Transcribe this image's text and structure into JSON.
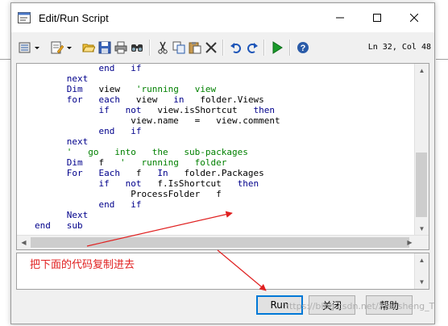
{
  "window": {
    "title": "Edit/Run Script"
  },
  "toolbar": {
    "cursor_position": "Ln 32, Col 48",
    "icons": [
      "code-menu-icon",
      "edit-menu-icon",
      "open-folder-icon",
      "save-icon",
      "print-icon",
      "find-icon",
      "cut-icon",
      "copy-icon",
      "paste-icon",
      "delete-icon",
      "undo-icon",
      "redo-icon",
      "run-icon",
      "help-icon"
    ]
  },
  "code_lines": [
    [
      {
        "t": "            end   if",
        "c": "kw"
      }
    ],
    [
      {
        "t": "      next",
        "c": "kw"
      }
    ],
    [
      {
        "t": "      Dim",
        "c": "kw"
      },
      {
        "t": "   view   ",
        "c": "id"
      },
      {
        "t": "'running   view",
        "c": "cm"
      }
    ],
    [
      {
        "t": "      for",
        "c": "kw"
      },
      {
        "t": "   ",
        "c": "id"
      },
      {
        "t": "each",
        "c": "kw"
      },
      {
        "t": "   view   ",
        "c": "id"
      },
      {
        "t": "in",
        "c": "kw"
      },
      {
        "t": "   folder.Views",
        "c": "id"
      }
    ],
    [
      {
        "t": "            if",
        "c": "kw"
      },
      {
        "t": "   ",
        "c": "id"
      },
      {
        "t": "not",
        "c": "kw"
      },
      {
        "t": "   view.isShortcut   ",
        "c": "id"
      },
      {
        "t": "then",
        "c": "kw"
      }
    ],
    [
      {
        "t": "                  view.name   =   view.comment",
        "c": "id"
      }
    ],
    [
      {
        "t": "            end   if",
        "c": "kw"
      }
    ],
    [
      {
        "t": "      next",
        "c": "kw"
      }
    ],
    [
      {
        "t": "      '   go   into   the   sub-packages",
        "c": "cm"
      }
    ],
    [
      {
        "t": "      Dim",
        "c": "kw"
      },
      {
        "t": "   f   ",
        "c": "id"
      },
      {
        "t": "'   running   folder",
        "c": "cm"
      }
    ],
    [
      {
        "t": "      For",
        "c": "kw"
      },
      {
        "t": "   ",
        "c": "id"
      },
      {
        "t": "Each",
        "c": "kw"
      },
      {
        "t": "   f   ",
        "c": "id"
      },
      {
        "t": "In",
        "c": "kw"
      },
      {
        "t": "   folder.Packages",
        "c": "id"
      }
    ],
    [
      {
        "t": "            if",
        "c": "kw"
      },
      {
        "t": "   ",
        "c": "id"
      },
      {
        "t": "not",
        "c": "kw"
      },
      {
        "t": "   f.IsShortcut   ",
        "c": "id"
      },
      {
        "t": "then",
        "c": "kw"
      }
    ],
    [
      {
        "t": "                  ProcessFolder   f",
        "c": "id"
      }
    ],
    [
      {
        "t": "            end   if",
        "c": "kw"
      }
    ],
    [
      {
        "t": "      Next",
        "c": "kw"
      }
    ],
    [
      {
        "t": "end   sub",
        "c": "kw"
      }
    ]
  ],
  "annotation": {
    "text": "把下面的代码复制进去",
    "color": "#e02020"
  },
  "buttons": {
    "run": "Run",
    "close": "关闭",
    "help": "帮助"
  },
  "watermark": "https://blog.csdn.net/Xiaosheng_T",
  "colors": {
    "keyword": "#00008b",
    "comment": "#008000",
    "annotation": "#e02020",
    "default_button_border": "#0078d7"
  }
}
